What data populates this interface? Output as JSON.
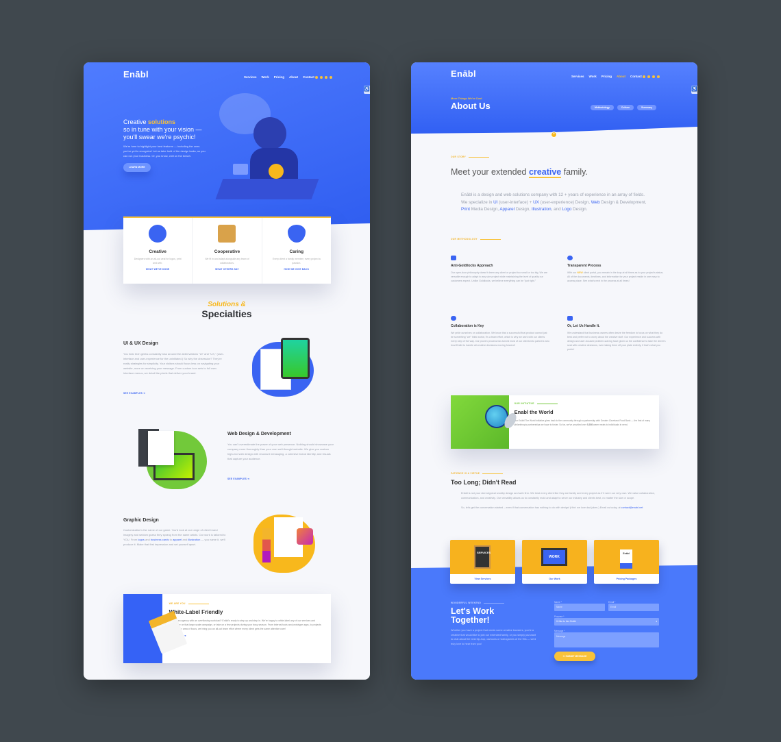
{
  "brand": "Enābl",
  "nav": [
    "Services",
    "Work",
    "Pricing",
    "About",
    "Contact"
  ],
  "home": {
    "hero_line1": "Creative ",
    "hero_accent": "solutions",
    "hero_line2": "so in tune with your vision —",
    "hero_line3": "you'll swear we're psychic!",
    "hero_text": "We're here to highlight your best features — including the ones you've yet to recognize! Let us take hold of the design tasks, so you can run your business. Or, you know, chill on the beach.",
    "hero_button": "LEARN MORE",
    "features": [
      {
        "title": "Creative",
        "text": "Designers with an all-out zeal for logos, print and web.",
        "link": "WHAT WE'VE DONE",
        "icon": "head-lightbulb-icon"
      },
      {
        "title": "Cooperative",
        "text": "We fit in and adapt alongside any team of collaborators.",
        "link": "WHAT OTHERS SAY",
        "icon": "cups-icon"
      },
      {
        "title": "Caring",
        "text": "Every client a family member; every project a passion.",
        "link": "HOW WE GIVE BACK",
        "icon": "heart-glasses-icon"
      }
    ],
    "solutions_script": "Solutions &",
    "solutions_title": "Specialties",
    "services": [
      {
        "title": "UI & UX Design",
        "text": "You hear tech geeks constantly toss around the abbreviations \"UI\" and \"UX,\" (user-interface and user-experience for the uninitiated.) So why the obsession? They're really strategies for simplicity. Your visitors should focus less on navigating your website, more on receiving your message. From custom icon sets to full user-interface menus, we detail the pixels that deliver your brand.",
        "link": "SEE EXAMPLES ➜"
      },
      {
        "title": "Web Design & Development",
        "text": "You can't overestimate the power of your web presence. Nothing should showcase your company more thoroughly than your own well-thought website. We give you custom high-end web design with resonant messaging, a cohesive brand identity, and visuals that capture your audience.",
        "link": "SEE EXAMPLES ➜"
      },
      {
        "title": "Graphic Design",
        "text_a": "Customization's the name of our game. You'd look at our range of client brand imagery and seldom guess they sprang from the same artists. Our work is tailored to YOU. From ",
        "l1": "logos",
        "t2": " and ",
        "l2": "business cards",
        "t3": " to ",
        "l3": "apparel",
        "t4": " and ",
        "l4": "illustration",
        "t5": " — you name it, we'll produce it. Make that first impression and set yourself apart."
      }
    ],
    "whitelabel": {
      "eyebrow": "WE ARE YOU",
      "title": "White-Label Friendly",
      "text": "Are you an agency with an overflowing workload? Enābl's ready to step up and step in. We're happy to white-label any of our services and collaborate on that large-scale campaign, or take on a few projects during your busy season. From internal tools and prototype apps, to projects beyond your area of focus, we bring you an all-out team effort where every client gets the same attentive care!",
      "link": "LET'S CHAT ➜",
      "badge": "Hello, my name is"
    }
  },
  "about": {
    "eyebrow": "More Things We're Cool",
    "title": "About Us",
    "pills": [
      "Methodology",
      "Culture",
      "Summary"
    ],
    "story_eyebrow": "OUR STORY",
    "headline_a": "Meet your extended ",
    "headline_accent": "creative",
    "headline_b": " family.",
    "intro": {
      "t1": "Enābl is a design and web solutions company with 12 + years of experience in an array of fields. We specialize in ",
      "l1": "UI",
      "t2": " (user-interface) + ",
      "l2": "UX",
      "t3": " (user-experience) Design, ",
      "l3": "Web",
      "t4": " Design & Development, ",
      "l4": "Print",
      "t5": " Media Design, ",
      "l5": "Apparel",
      "t6": " Design, ",
      "l6": "Illustration",
      "t7": ", and ",
      "l7": "Logo",
      "t8": " Design."
    },
    "method_eyebrow": "OUR METHODOLOGY",
    "methods": [
      {
        "title": "Anti-Goldilocks Approach",
        "text": "Our open-door philosophy doesn't deem any client or project too small or too big. We are versatile enough to adapt to any size project while maintaining the level of quality our customers expect. Unlike Goldilocks, we believe everything can be \"just right.\"",
        "icon": "door-icon"
      },
      {
        "title": "Transparent Process",
        "pre": "With our ",
        "hl": "NEW",
        "text": " client portal, you remain in the loop at all times as to your project's status. All of the documents, timelines, and information for your project reside in one easy to access place. See what's next in the process at all times!",
        "icon": "eye-icon"
      },
      {
        "title": "Collaboration is Key",
        "text": "We pride ourselves on collaboration. We know that a successful final product cannot just be something \"we\" think works; it's a team effort, which is why we work with our clients every step of the way. Our proven process has turned most of our clients into partners who trust Enābl to handle all creative decisions moving forward!",
        "icon": "chat-bubbles-icon"
      },
      {
        "title": "Or, Let Us Handle It.",
        "text": "We understand that business owners often desire the freedom to focus on what they do best and prefer not to worry about the creative stuff. Our experience and success with design and user-focused problem-solving have given us the confidence to take the driver's seat with creative decisions, even taking them off your plate entirely, if that's what you prefer!",
        "icon": "hidden-eye-icon"
      }
    ],
    "world": {
      "eyebrow": "OUR INITIATIVE",
      "title": "Enabl the World",
      "text": "Our Enābl The World initiative gives back to the community through a partnership with Greater Cleveland Food Bank — the first of many philanthropic partnerships we hope to foster. So far, we've provided over ",
      "num": "5,308",
      "text2": " warm meals to individuals in need."
    },
    "tldr": {
      "eyebrow": "PATIENCE IS A VIRTUE",
      "title": "Too Long; Didn't Read",
      "p1": "Enābl is not your stereotypical snobby design and web firm. We treat every client like they are family and every project as if it were our very own. We value collaboration, communication, and creativity. Our versatility allows us to constantly mold and adapt to serve our industry and clients best, no matter the size or scope.",
      "p2": "So, let's get the conversation started – even if that conversation has nothing to do with design! (Hint: we love dad jokes.) Email us today, at ",
      "email": "contact@enabl.net"
    },
    "tiles": [
      {
        "label": "View Services",
        "sign": "SERVICES"
      },
      {
        "label": "Our Work",
        "sign": "WORK"
      },
      {
        "label": "Pricing Packages",
        "sign": "Enābl"
      }
    ],
    "contact": {
      "eyebrow": "WONDERFUL WEEKEND",
      "title1": "Let's Work",
      "title2": "Together!",
      "text": "Whether you have a project that needs some creative boosters, you're a creative that would like to join our extended family, or you simply just want to chat about the best hip-hop, cartoons or videogames of the 90s — we'd truly love to hear from you!",
      "name_label": "Name *",
      "name_ph": "Name",
      "email_label": "Email *",
      "email_ph": "Email",
      "purpose_label": "Purpose *",
      "purpose_value": "I'd like to hire Enābl",
      "message_label": "Message *",
      "message_ph": "Message",
      "submit": "SUBMIT MESSAGE"
    }
  },
  "colors": {
    "blue": "#3a64f2",
    "yellow": "#f8c23a",
    "green": "#72c93a",
    "bg": "#40484e"
  }
}
